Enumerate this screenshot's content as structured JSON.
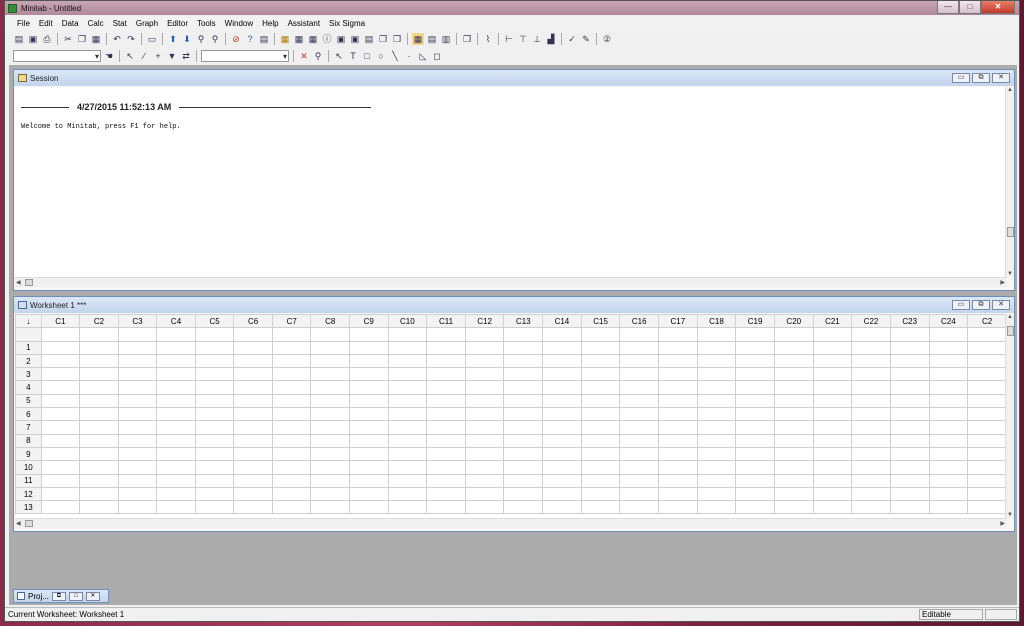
{
  "window": {
    "title": "Minitab - Untitled",
    "minimize": "—",
    "maximize": "□",
    "close": "✕"
  },
  "menu": [
    "File",
    "Edit",
    "Data",
    "Calc",
    "Stat",
    "Graph",
    "Editor",
    "Tools",
    "Window",
    "Help",
    "Assistant",
    "Six Sigma"
  ],
  "session": {
    "title": "Session",
    "datetime": "4/27/2015 11:52:13 AM",
    "welcome": "Welcome to Minitab, press F1 for help."
  },
  "worksheet": {
    "title": "Worksheet 1 ***",
    "corner": "↓",
    "columns": [
      "C1",
      "C2",
      "C3",
      "C4",
      "C5",
      "C6",
      "C7",
      "C8",
      "C9",
      "C10",
      "C11",
      "C12",
      "C13",
      "C14",
      "C15",
      "C16",
      "C17",
      "C18",
      "C19",
      "C20",
      "C21",
      "C22",
      "C23",
      "C24",
      "C2"
    ],
    "rows": [
      "1",
      "2",
      "3",
      "4",
      "5",
      "6",
      "7",
      "8",
      "9",
      "10",
      "11",
      "12",
      "13"
    ]
  },
  "project_window": {
    "title": "Proj..."
  },
  "status": {
    "left": "Current Worksheet: Worksheet 1",
    "right": "Editable"
  },
  "child_buttons": {
    "minimize": "▭",
    "restore": "⧉",
    "close": "✕"
  }
}
